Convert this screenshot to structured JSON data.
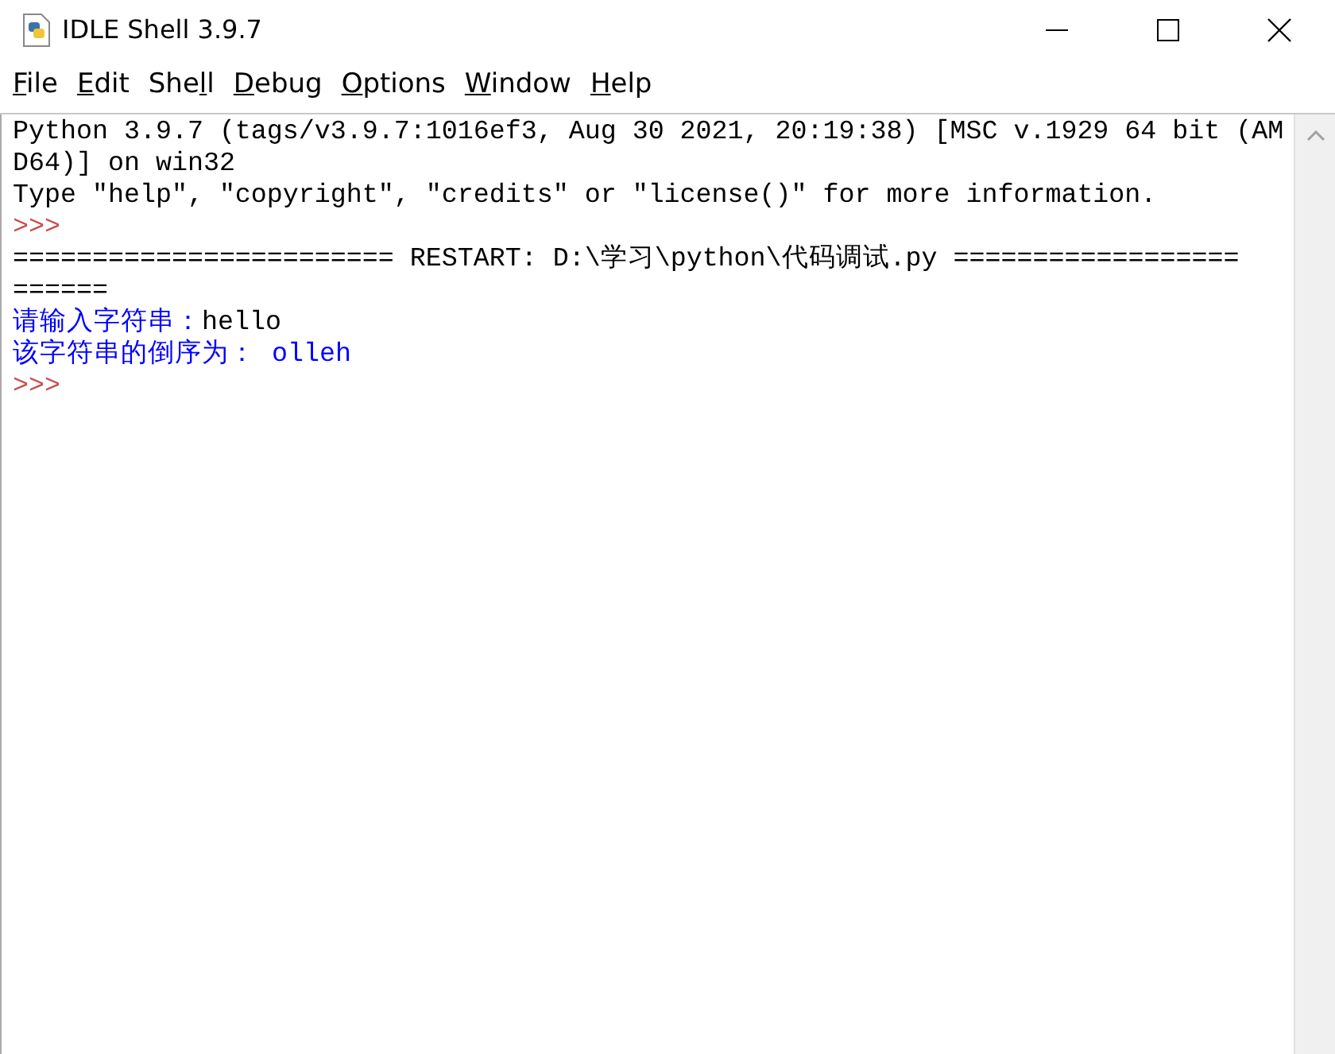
{
  "window": {
    "title": "IDLE Shell 3.9.7"
  },
  "menu": [
    {
      "key": "F",
      "post": "ile"
    },
    {
      "key": "E",
      "post": "dit"
    },
    {
      "pre": "She",
      "key": "l",
      "post": "l"
    },
    {
      "key": "D",
      "post": "ebug"
    },
    {
      "key": "O",
      "post": "ptions"
    },
    {
      "key": "W",
      "post": "indow"
    },
    {
      "key": "H",
      "post": "elp"
    }
  ],
  "shell_lines": [
    {
      "segments": [
        {
          "kind": "output",
          "text": "Python 3.9.7 (tags/v3.9.7:1016ef3, Aug 30 2021, 20:19:38) [MSC v.1929 64 bit (AM"
        }
      ]
    },
    {
      "segments": [
        {
          "kind": "output",
          "text": "D64)] on win32"
        }
      ]
    },
    {
      "segments": [
        {
          "kind": "output",
          "text": "Type \"help\", \"copyright\", \"credits\" or \"license()\" for more information."
        }
      ]
    },
    {
      "segments": [
        {
          "kind": "prompt",
          "text": ">>>"
        }
      ]
    },
    {
      "segments": [
        {
          "kind": "output",
          "text": "======================== RESTART: D:\\学习\\python\\代码调试.py =================="
        }
      ]
    },
    {
      "segments": [
        {
          "kind": "output",
          "text": "======"
        }
      ]
    },
    {
      "segments": [
        {
          "kind": "stdout",
          "text": "请输入字符串："
        },
        {
          "kind": "stdin",
          "text": "hello"
        }
      ]
    },
    {
      "segments": [
        {
          "kind": "stdout",
          "text": "该字符串的倒序为： olleh"
        }
      ]
    },
    {
      "segments": [
        {
          "kind": "prompt",
          "text": ">>>"
        }
      ]
    }
  ]
}
